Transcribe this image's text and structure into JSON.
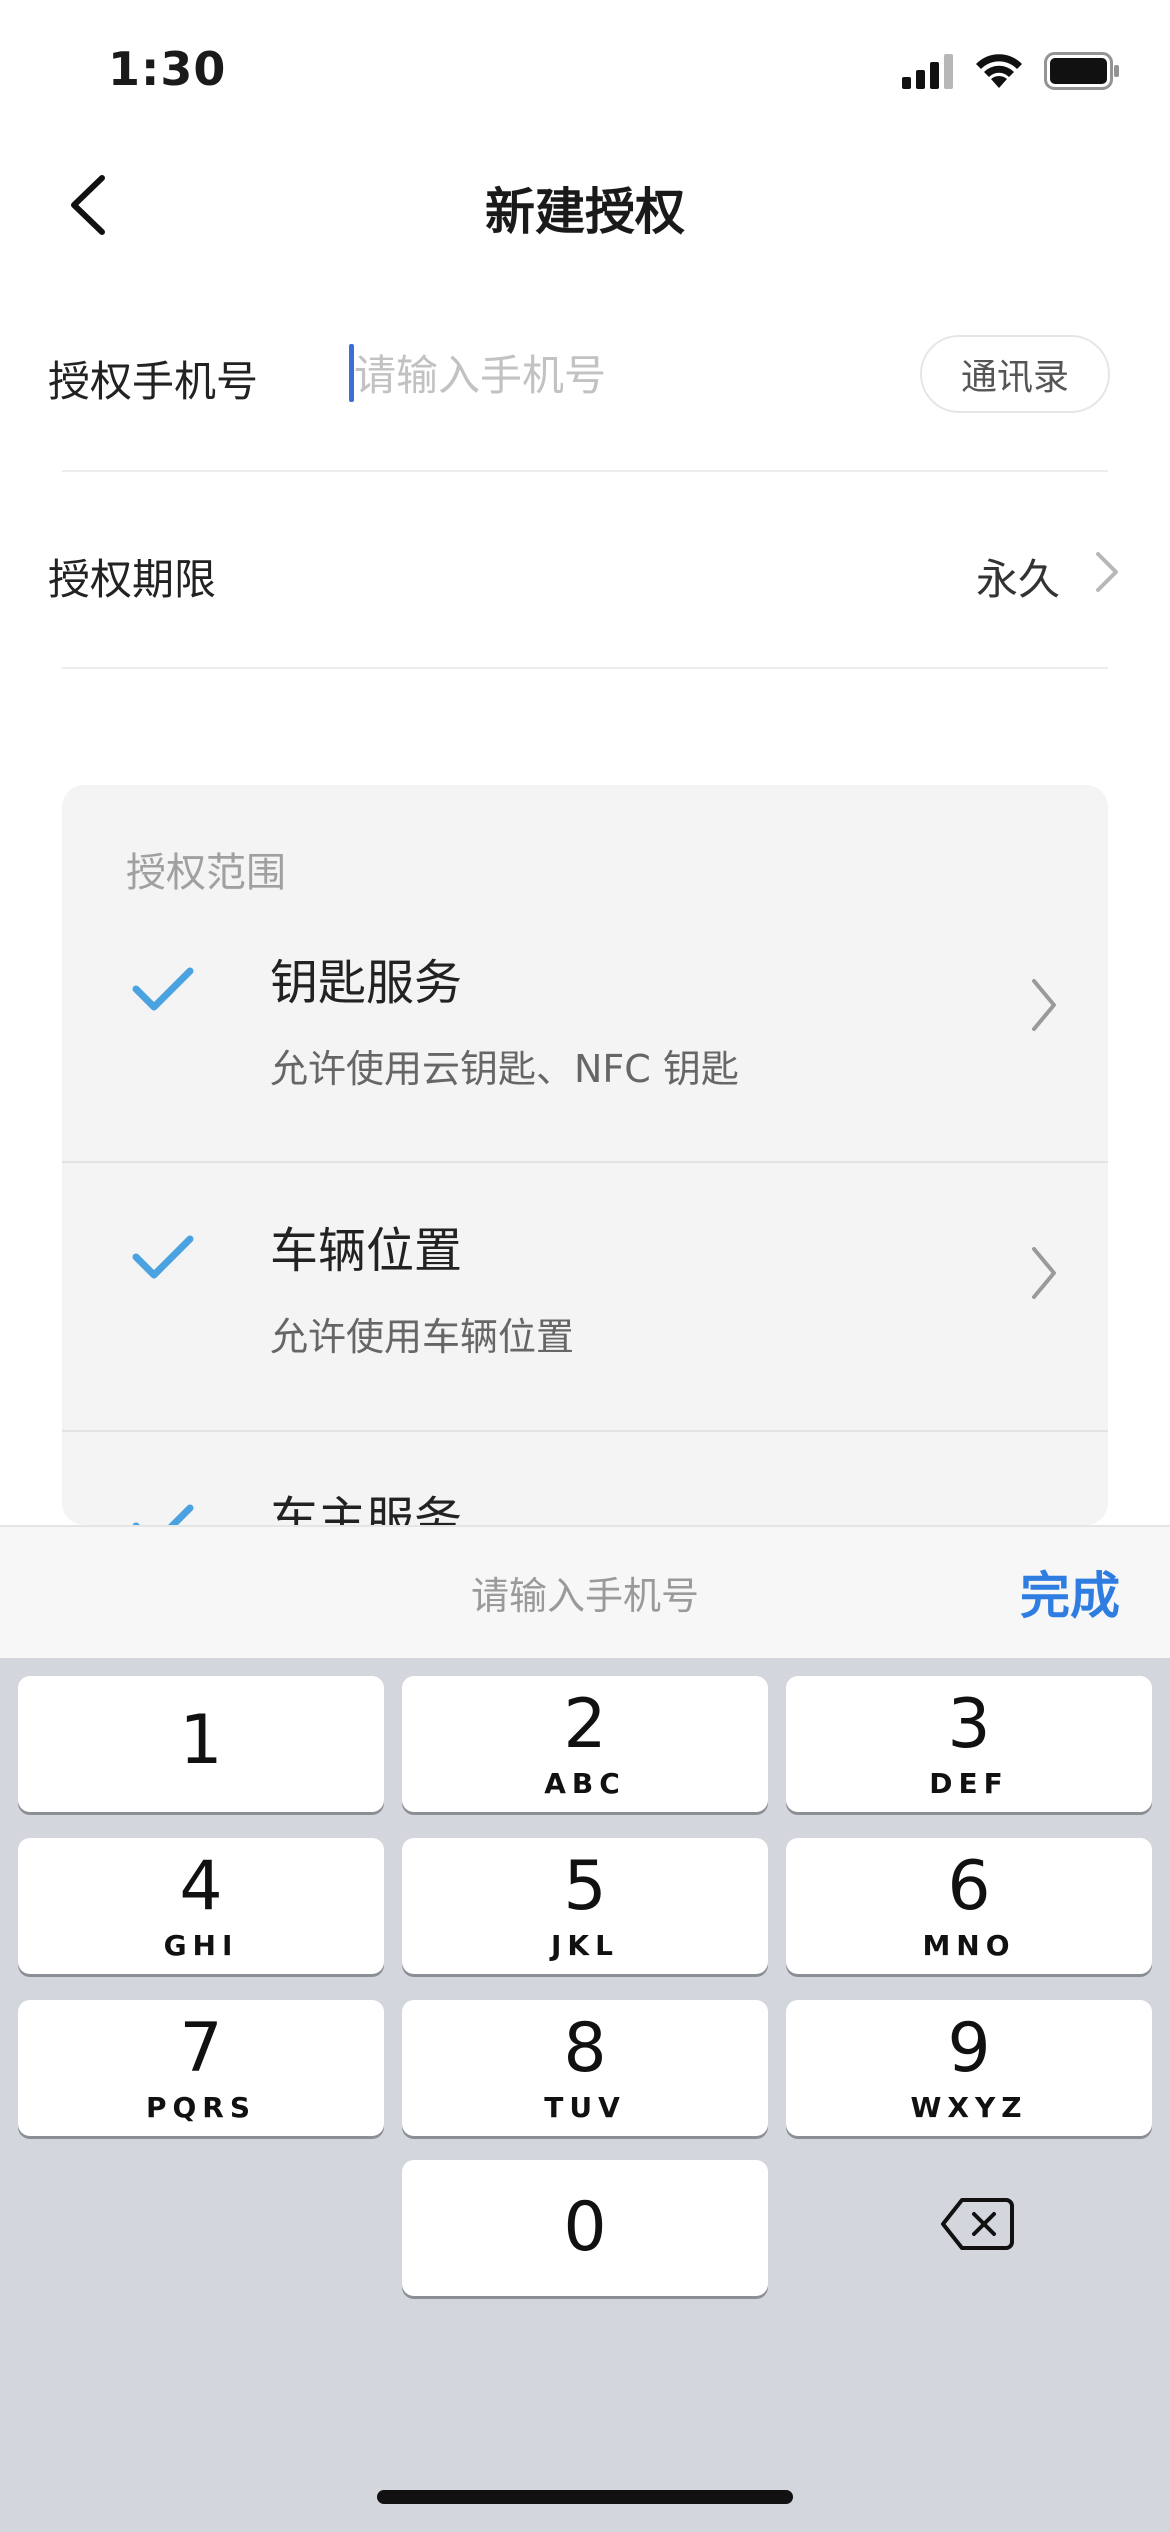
{
  "status_bar": {
    "time": "1:30",
    "icons": [
      "cellular-signal-icon",
      "wifi-icon",
      "battery-icon"
    ]
  },
  "nav": {
    "back_icon": "chevron-left-icon",
    "title": "新建授权"
  },
  "form": {
    "phone": {
      "label": "授权手机号",
      "value": "",
      "placeholder": "请输入手机号",
      "contacts_label": "通讯录"
    },
    "period": {
      "label": "授权期限",
      "value": "永久"
    }
  },
  "scope": {
    "title": "授权范围",
    "items": [
      {
        "name": "钥匙服务",
        "desc": "允许使用云钥匙、NFC 钥匙",
        "checked": true
      },
      {
        "name": "车辆位置",
        "desc": "允许使用车辆位置",
        "checked": true
      },
      {
        "name": "车主服务",
        "desc": "",
        "checked": true
      }
    ]
  },
  "input_bar": {
    "hint": "请输入手机号",
    "done_label": "完成"
  },
  "keyboard": {
    "keys": [
      {
        "digit": "1",
        "letters": ""
      },
      {
        "digit": "2",
        "letters": "ABC"
      },
      {
        "digit": "3",
        "letters": "DEF"
      },
      {
        "digit": "4",
        "letters": "GHI"
      },
      {
        "digit": "5",
        "letters": "JKL"
      },
      {
        "digit": "6",
        "letters": "MNO"
      },
      {
        "digit": "7",
        "letters": "PQRS"
      },
      {
        "digit": "8",
        "letters": "TUV"
      },
      {
        "digit": "9",
        "letters": "WXYZ"
      },
      {
        "digit": "0",
        "letters": ""
      }
    ],
    "delete_icon": "backspace-icon"
  },
  "colors": {
    "accent": "#2f7de0",
    "check": "#4aa3e0",
    "caret": "#3b6fd6",
    "keyboard_bg": "#d3d6dc"
  }
}
